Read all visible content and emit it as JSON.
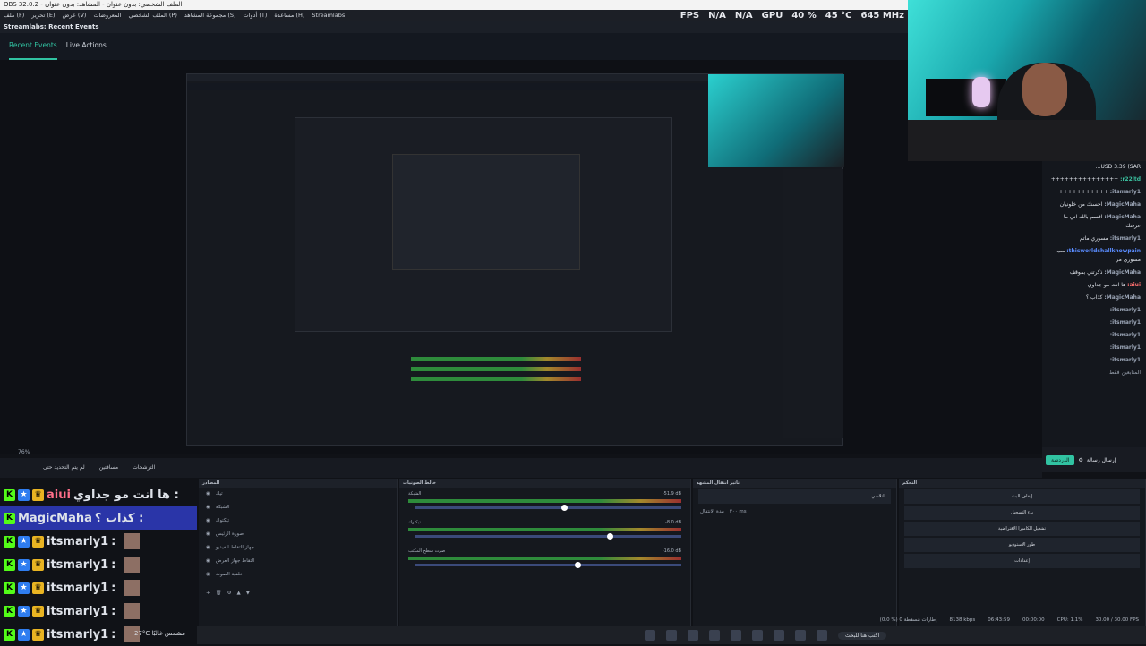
{
  "window": {
    "title": "OBS 32.0.2 - الملف الشخصي: بدون عنوان - المشاهد: بدون عنوان"
  },
  "menu": [
    "ملف (F)",
    "تحرير (E)",
    "عرض (V)",
    "المعروضات",
    "الملف الشخصي (P)",
    "مجموعة المشاهد (S)",
    "أدوات (T)",
    "مساعدة (H)",
    "Streamlabs"
  ],
  "stats": {
    "fps_label": "FPS",
    "fps_value": "N/A",
    "fps_value2": "N/A",
    "gpu_label": "GPU",
    "gpu_percent": "40 %",
    "gpu_temp": "45 °C",
    "gpu_mhz": "645 MHz"
  },
  "dock": {
    "title": "Streamlabs: Recent Events",
    "tab1": "Recent Events",
    "tab2": "Live Actions"
  },
  "zoom": "76%",
  "scene_bar": {
    "item1": "الترشحات",
    "item2": "مسافتين",
    "item3": "لم يتم التحديد حتى"
  },
  "chat_overlay": [
    {
      "user": "aiui",
      "text": "ها انت مو جداوي :"
    },
    {
      "user": "MagicMaha",
      "text": "كذاب ؟ :"
    },
    {
      "user": "itsmarly1",
      "text": ":"
    },
    {
      "user": "itsmarly1",
      "text": ":"
    },
    {
      "user": "itsmarly1",
      "text": ":"
    },
    {
      "user": "itsmarly1",
      "text": ":"
    },
    {
      "user": "itsmarly1",
      "text": ":"
    }
  ],
  "side_chat": [
    {
      "user": "",
      "text": "USD 3.39 (SAR..."
    },
    {
      "user": "r22ltd:",
      "text": "+++++++++++++++"
    },
    {
      "user": "itsmarly1:",
      "text": "+++++++++++"
    },
    {
      "user": "MagicMaha:",
      "text": "احسنك من خلونيان"
    },
    {
      "user": "MagicMaha:",
      "text": "اقسم بالله اني ما عرفتك"
    },
    {
      "user": "itsmarly1:",
      "text": "مسوري ماتم"
    },
    {
      "user": "thisworldshallknowpain:",
      "text": "مب مسوري مر"
    },
    {
      "user": "MagicMaha:",
      "text": "ذكرتني بموقف"
    },
    {
      "user": "aiui:",
      "text": "ها انت مو جداوي"
    },
    {
      "user": "MagicMaha:",
      "text": "كذاب ؟"
    },
    {
      "user": "itsmarly1:",
      "text": ""
    },
    {
      "user": "itsmarly1:",
      "text": ""
    },
    {
      "user": "itsmarly1:",
      "text": ""
    },
    {
      "user": "itsmarly1:",
      "text": ""
    },
    {
      "user": "itsmarly1:",
      "text": ""
    }
  ],
  "chat_input": {
    "placeholder": "إرسال رسالة",
    "send": "الدردشة",
    "followers": "المتابعين فقط"
  },
  "sources": {
    "title": "المصادر",
    "items": [
      "تيك",
      "الشبكة",
      "تيكتوك",
      "صورة الرئيس",
      "جهاز التقاط الفيديو",
      "التقاط جهاز العرض",
      "خلفية الصوت"
    ]
  },
  "mixer": {
    "title": "خالط الصوتيات",
    "tracks": [
      {
        "name": "الشبكة",
        "db": "-51.9 dB",
        "level": 0.55
      },
      {
        "name": "تيكتوك",
        "db": "-8.0 dB",
        "level": 0.72
      },
      {
        "name": "صوت سطح المكتب",
        "db": "-16.0 dB",
        "level": 0.6
      }
    ]
  },
  "transitions": {
    "title": "تأثير انتقال المشهد",
    "type": "التلاشي",
    "duration_label": "مدة الانتقال",
    "duration": "٣٠٠ ms"
  },
  "controls": {
    "title": "التحكم",
    "buttons": [
      "إيقاف البث",
      "بدء التسجيل",
      "تشغيل الكاميرا الافتراضية",
      "طور الاستوديو",
      "إعدادات"
    ]
  },
  "statusbar": {
    "dropped": "(0.0 %) 0 إطارات مُسقطة",
    "bitrate": "8138 kbps",
    "live_time": "06:43:59",
    "rec_time": "00:00:00",
    "cpu": "CPU: 1.1%",
    "fps": "30.00 / 30.00 FPS"
  },
  "taskbar": {
    "weather": "27°C  مشمس غالبًا",
    "search": "اكتب هنا للبحث"
  },
  "colors": {
    "accent": "#31c3a2",
    "kick": "#53fc18",
    "highlight": "#2a35a8"
  }
}
